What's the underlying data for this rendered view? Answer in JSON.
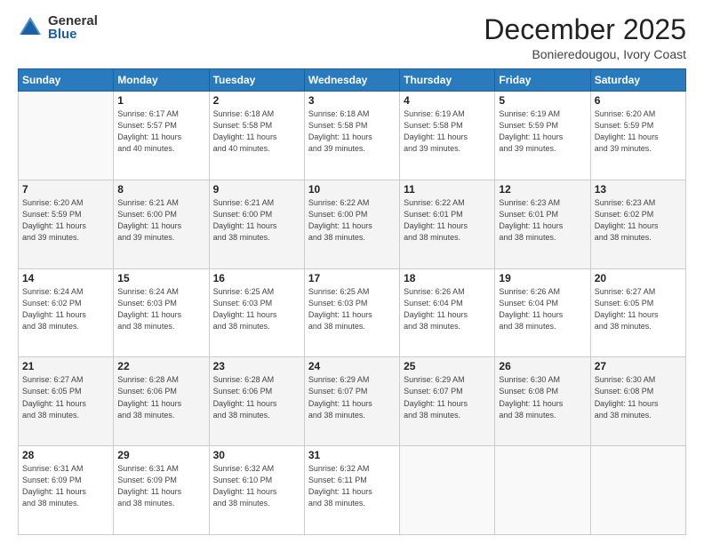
{
  "logo": {
    "general": "General",
    "blue": "Blue"
  },
  "header": {
    "month": "December 2025",
    "location": "Bonieredougou, Ivory Coast"
  },
  "weekdays": [
    "Sunday",
    "Monday",
    "Tuesday",
    "Wednesday",
    "Thursday",
    "Friday",
    "Saturday"
  ],
  "weeks": [
    [
      {
        "day": "",
        "info": ""
      },
      {
        "day": "1",
        "info": "Sunrise: 6:17 AM\nSunset: 5:57 PM\nDaylight: 11 hours\nand 40 minutes."
      },
      {
        "day": "2",
        "info": "Sunrise: 6:18 AM\nSunset: 5:58 PM\nDaylight: 11 hours\nand 40 minutes."
      },
      {
        "day": "3",
        "info": "Sunrise: 6:18 AM\nSunset: 5:58 PM\nDaylight: 11 hours\nand 39 minutes."
      },
      {
        "day": "4",
        "info": "Sunrise: 6:19 AM\nSunset: 5:58 PM\nDaylight: 11 hours\nand 39 minutes."
      },
      {
        "day": "5",
        "info": "Sunrise: 6:19 AM\nSunset: 5:59 PM\nDaylight: 11 hours\nand 39 minutes."
      },
      {
        "day": "6",
        "info": "Sunrise: 6:20 AM\nSunset: 5:59 PM\nDaylight: 11 hours\nand 39 minutes."
      }
    ],
    [
      {
        "day": "7",
        "info": "Sunrise: 6:20 AM\nSunset: 5:59 PM\nDaylight: 11 hours\nand 39 minutes."
      },
      {
        "day": "8",
        "info": "Sunrise: 6:21 AM\nSunset: 6:00 PM\nDaylight: 11 hours\nand 39 minutes."
      },
      {
        "day": "9",
        "info": "Sunrise: 6:21 AM\nSunset: 6:00 PM\nDaylight: 11 hours\nand 38 minutes."
      },
      {
        "day": "10",
        "info": "Sunrise: 6:22 AM\nSunset: 6:00 PM\nDaylight: 11 hours\nand 38 minutes."
      },
      {
        "day": "11",
        "info": "Sunrise: 6:22 AM\nSunset: 6:01 PM\nDaylight: 11 hours\nand 38 minutes."
      },
      {
        "day": "12",
        "info": "Sunrise: 6:23 AM\nSunset: 6:01 PM\nDaylight: 11 hours\nand 38 minutes."
      },
      {
        "day": "13",
        "info": "Sunrise: 6:23 AM\nSunset: 6:02 PM\nDaylight: 11 hours\nand 38 minutes."
      }
    ],
    [
      {
        "day": "14",
        "info": "Sunrise: 6:24 AM\nSunset: 6:02 PM\nDaylight: 11 hours\nand 38 minutes."
      },
      {
        "day": "15",
        "info": "Sunrise: 6:24 AM\nSunset: 6:03 PM\nDaylight: 11 hours\nand 38 minutes."
      },
      {
        "day": "16",
        "info": "Sunrise: 6:25 AM\nSunset: 6:03 PM\nDaylight: 11 hours\nand 38 minutes."
      },
      {
        "day": "17",
        "info": "Sunrise: 6:25 AM\nSunset: 6:03 PM\nDaylight: 11 hours\nand 38 minutes."
      },
      {
        "day": "18",
        "info": "Sunrise: 6:26 AM\nSunset: 6:04 PM\nDaylight: 11 hours\nand 38 minutes."
      },
      {
        "day": "19",
        "info": "Sunrise: 6:26 AM\nSunset: 6:04 PM\nDaylight: 11 hours\nand 38 minutes."
      },
      {
        "day": "20",
        "info": "Sunrise: 6:27 AM\nSunset: 6:05 PM\nDaylight: 11 hours\nand 38 minutes."
      }
    ],
    [
      {
        "day": "21",
        "info": "Sunrise: 6:27 AM\nSunset: 6:05 PM\nDaylight: 11 hours\nand 38 minutes."
      },
      {
        "day": "22",
        "info": "Sunrise: 6:28 AM\nSunset: 6:06 PM\nDaylight: 11 hours\nand 38 minutes."
      },
      {
        "day": "23",
        "info": "Sunrise: 6:28 AM\nSunset: 6:06 PM\nDaylight: 11 hours\nand 38 minutes."
      },
      {
        "day": "24",
        "info": "Sunrise: 6:29 AM\nSunset: 6:07 PM\nDaylight: 11 hours\nand 38 minutes."
      },
      {
        "day": "25",
        "info": "Sunrise: 6:29 AM\nSunset: 6:07 PM\nDaylight: 11 hours\nand 38 minutes."
      },
      {
        "day": "26",
        "info": "Sunrise: 6:30 AM\nSunset: 6:08 PM\nDaylight: 11 hours\nand 38 minutes."
      },
      {
        "day": "27",
        "info": "Sunrise: 6:30 AM\nSunset: 6:08 PM\nDaylight: 11 hours\nand 38 minutes."
      }
    ],
    [
      {
        "day": "28",
        "info": "Sunrise: 6:31 AM\nSunset: 6:09 PM\nDaylight: 11 hours\nand 38 minutes."
      },
      {
        "day": "29",
        "info": "Sunrise: 6:31 AM\nSunset: 6:09 PM\nDaylight: 11 hours\nand 38 minutes."
      },
      {
        "day": "30",
        "info": "Sunrise: 6:32 AM\nSunset: 6:10 PM\nDaylight: 11 hours\nand 38 minutes."
      },
      {
        "day": "31",
        "info": "Sunrise: 6:32 AM\nSunset: 6:11 PM\nDaylight: 11 hours\nand 38 minutes."
      },
      {
        "day": "",
        "info": ""
      },
      {
        "day": "",
        "info": ""
      },
      {
        "day": "",
        "info": ""
      }
    ]
  ]
}
